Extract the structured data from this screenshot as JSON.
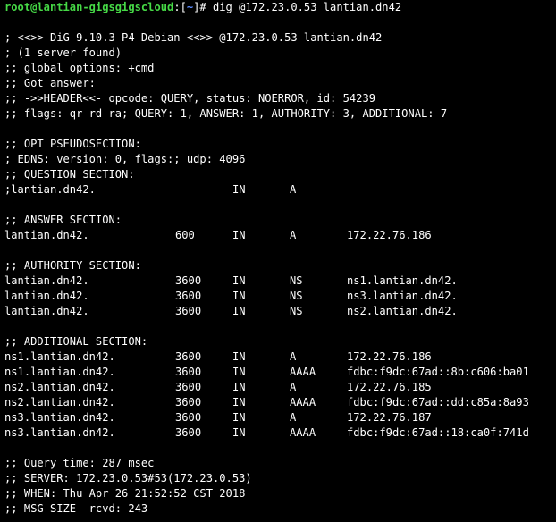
{
  "prompt": {
    "user_host": "root@lantian-gigsgigscloud",
    "path_open": ":[",
    "path": "~",
    "path_close": "]# ",
    "command": "dig @172.23.0.53 lantian.dn42"
  },
  "header_lines": [
    "",
    "; <<>> DiG 9.10.3-P4-Debian <<>> @172.23.0.53 lantian.dn42",
    "; (1 server found)",
    ";; global options: +cmd",
    ";; Got answer:",
    ";; ->>HEADER<<- opcode: QUERY, status: NOERROR, id: 54239",
    ";; flags: qr rd ra; QUERY: 1, ANSWER: 1, AUTHORITY: 3, ADDITIONAL: 7",
    "",
    ";; OPT PSEUDOSECTION:",
    "; EDNS: version: 0, flags:; udp: 4096",
    ";; QUESTION SECTION:"
  ],
  "question": {
    "name": ";lantian.dn42.",
    "ttl": "",
    "class": "IN",
    "type": "A",
    "data": ""
  },
  "answer_header": ";; ANSWER SECTION:",
  "answer": [
    {
      "name": "lantian.dn42.",
      "ttl": "600",
      "class": "IN",
      "type": "A",
      "data": "172.22.76.186"
    }
  ],
  "authority_header": ";; AUTHORITY SECTION:",
  "authority": [
    {
      "name": "lantian.dn42.",
      "ttl": "3600",
      "class": "IN",
      "type": "NS",
      "data": "ns1.lantian.dn42."
    },
    {
      "name": "lantian.dn42.",
      "ttl": "3600",
      "class": "IN",
      "type": "NS",
      "data": "ns3.lantian.dn42."
    },
    {
      "name": "lantian.dn42.",
      "ttl": "3600",
      "class": "IN",
      "type": "NS",
      "data": "ns2.lantian.dn42."
    }
  ],
  "additional_header": ";; ADDITIONAL SECTION:",
  "additional": [
    {
      "name": "ns1.lantian.dn42.",
      "ttl": "3600",
      "class": "IN",
      "type": "A",
      "data": "172.22.76.186"
    },
    {
      "name": "ns1.lantian.dn42.",
      "ttl": "3600",
      "class": "IN",
      "type": "AAAA",
      "data": "fdbc:f9dc:67ad::8b:c606:ba01"
    },
    {
      "name": "ns2.lantian.dn42.",
      "ttl": "3600",
      "class": "IN",
      "type": "A",
      "data": "172.22.76.185"
    },
    {
      "name": "ns2.lantian.dn42.",
      "ttl": "3600",
      "class": "IN",
      "type": "AAAA",
      "data": "fdbc:f9dc:67ad::dd:c85a:8a93"
    },
    {
      "name": "ns3.lantian.dn42.",
      "ttl": "3600",
      "class": "IN",
      "type": "A",
      "data": "172.22.76.187"
    },
    {
      "name": "ns3.lantian.dn42.",
      "ttl": "3600",
      "class": "IN",
      "type": "AAAA",
      "data": "fdbc:f9dc:67ad::18:ca0f:741d"
    }
  ],
  "footer_lines": [
    ";; Query time: 287 msec",
    ";; SERVER: 172.23.0.53#53(172.23.0.53)",
    ";; WHEN: Thu Apr 26 21:52:52 CST 2018",
    ";; MSG SIZE  rcvd: 243"
  ],
  "colors": {
    "background": "#000000",
    "foreground": "#ffffff",
    "prompt_user": "#46d946",
    "prompt_path": "#5c8cff"
  }
}
